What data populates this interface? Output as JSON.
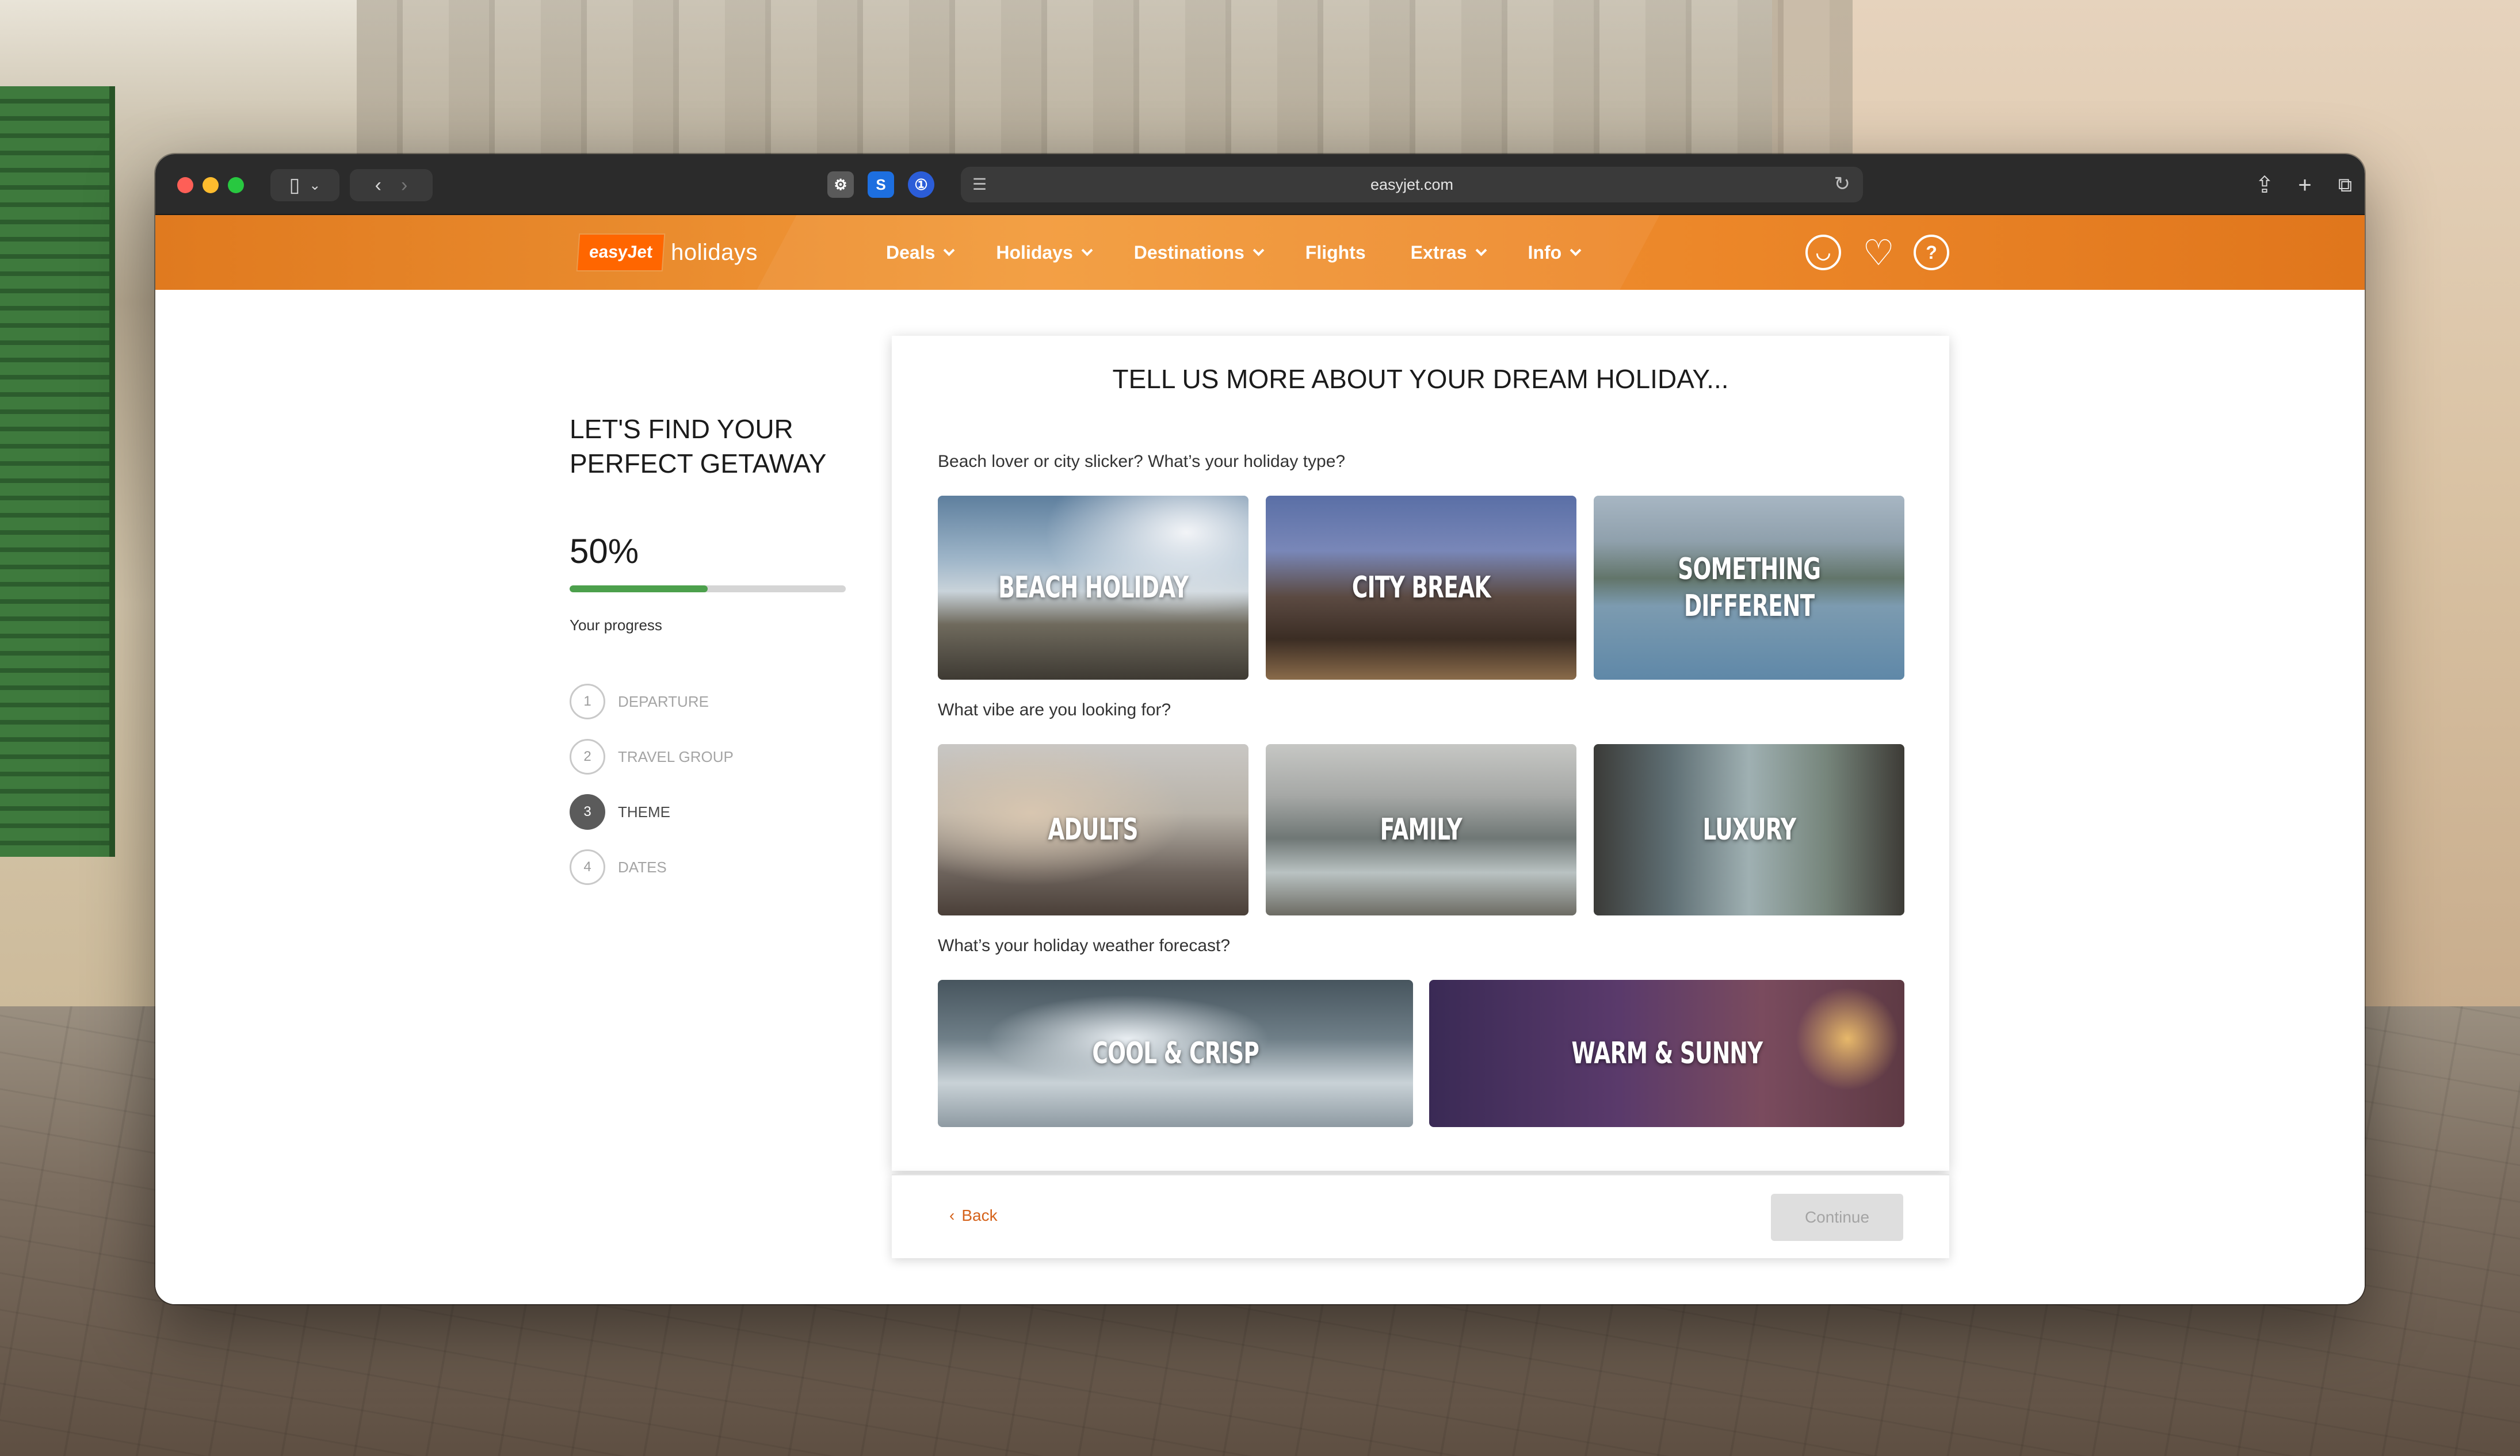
{
  "browser": {
    "url": "easyjet.com"
  },
  "header": {
    "logo_brand": "easyJet",
    "logo_product": "holidays",
    "nav": [
      {
        "label": "Deals",
        "has_dropdown": true
      },
      {
        "label": "Holidays",
        "has_dropdown": true
      },
      {
        "label": "Destinations",
        "has_dropdown": true
      },
      {
        "label": "Flights",
        "has_dropdown": false
      },
      {
        "label": "Extras",
        "has_dropdown": true
      },
      {
        "label": "Info",
        "has_dropdown": true
      }
    ],
    "icons": [
      "account-icon",
      "heart-icon",
      "help-icon"
    ],
    "help_glyph": "?"
  },
  "sidebar": {
    "title": "LET'S FIND YOUR PERFECT GETAWAY",
    "progress_value": 50,
    "progress_text": "50%",
    "progress_label": "Your progress",
    "steps": [
      {
        "number": "1",
        "label": "DEPARTURE",
        "active": false
      },
      {
        "number": "2",
        "label": "TRAVEL GROUP",
        "active": false
      },
      {
        "number": "3",
        "label": "THEME",
        "active": true
      },
      {
        "number": "4",
        "label": "DATES",
        "active": false
      }
    ]
  },
  "main": {
    "heading": "TELL US MORE ABOUT YOUR DREAM HOLIDAY...",
    "sections": [
      {
        "question": "Beach lover or city slicker? What’s your holiday type?",
        "options": [
          "BEACH HOLIDAY",
          "CITY BREAK",
          "SOMETHING\nDIFFERENT"
        ]
      },
      {
        "question": "What vibe are you looking for?",
        "options": [
          "ADULTS",
          "FAMILY",
          "LUXURY"
        ]
      },
      {
        "question": "What’s your holiday weather forecast?",
        "options": [
          "COOL & CRISP",
          "WARM & SUNNY"
        ]
      }
    ]
  },
  "footer": {
    "back_label": "Back",
    "continue_label": "Continue"
  },
  "colors": {
    "brand_orange": "#ff6600",
    "progress_green": "#4ca04c",
    "link_orange": "#d5621a"
  }
}
